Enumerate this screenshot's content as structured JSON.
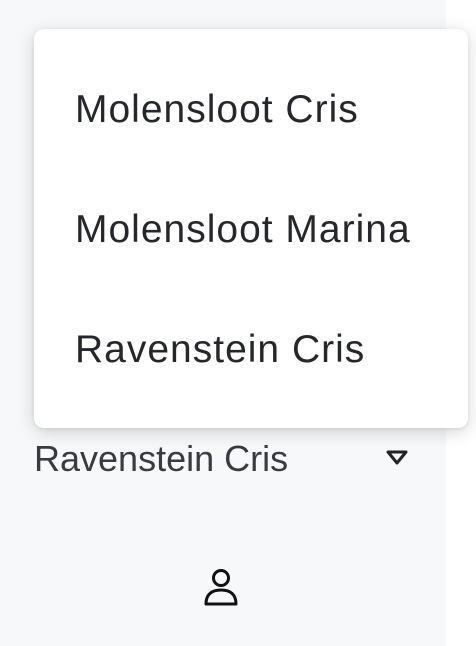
{
  "dropdown": {
    "options": [
      {
        "label": "Molensloot Cris"
      },
      {
        "label": "Molensloot Marina"
      },
      {
        "label": "Ravenstein Cris"
      }
    ]
  },
  "select": {
    "value": "Ravenstein Cris",
    "icon": "chevron-down-icon"
  },
  "footer": {
    "icon": "user-icon"
  }
}
